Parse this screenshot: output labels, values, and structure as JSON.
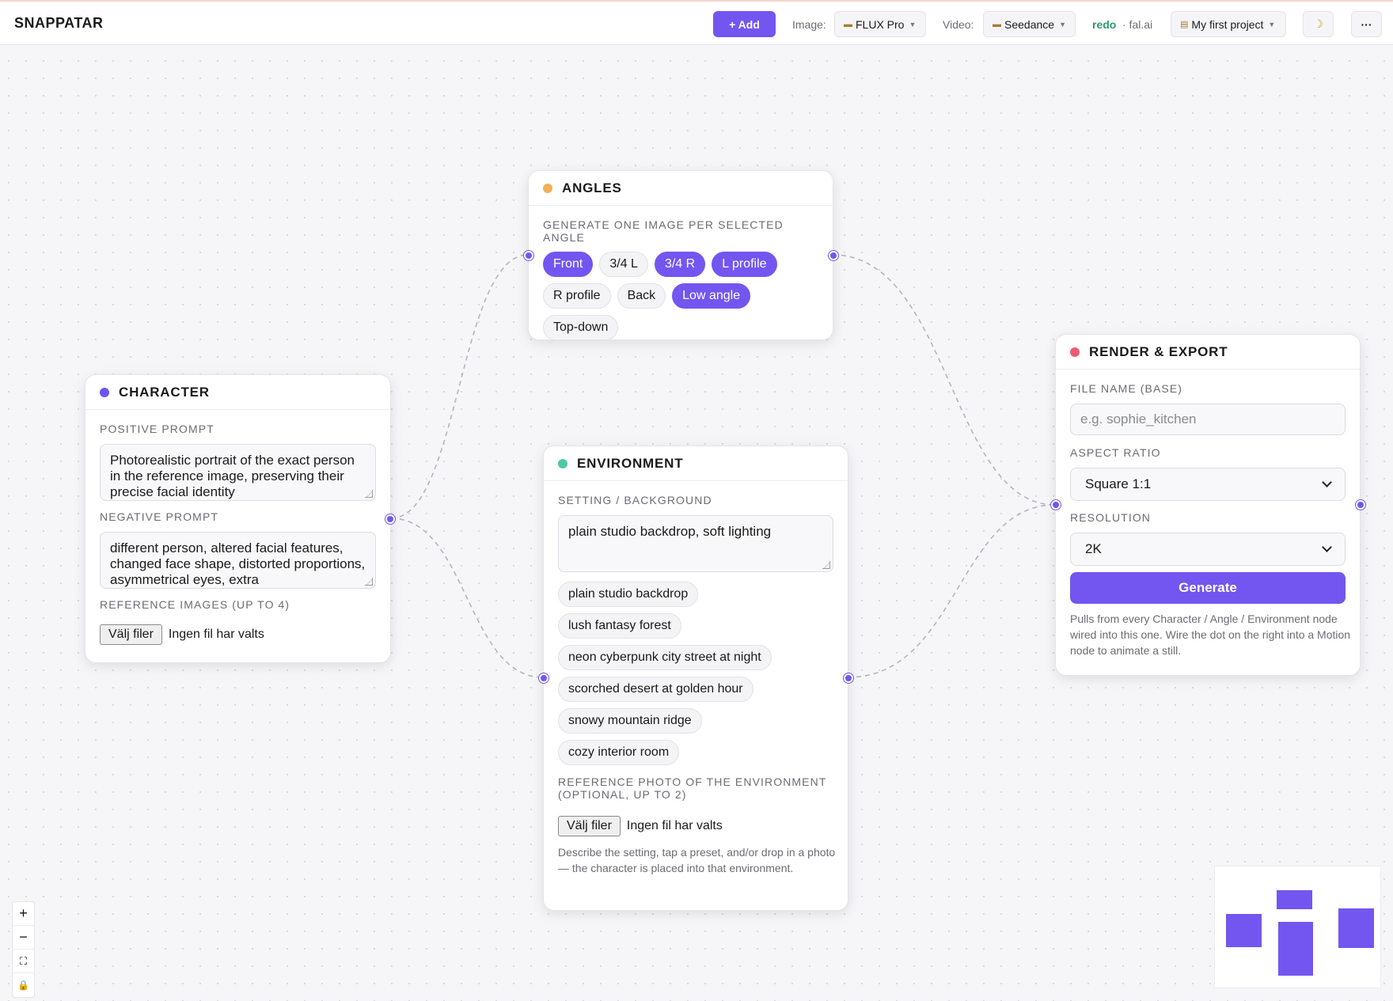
{
  "app": {
    "brand": "SNAPPATAR"
  },
  "toolbar": {
    "add_label": "+ Add",
    "image_label": "Image:",
    "image_model": "FLUX Pro",
    "video_label": "Video:",
    "video_model": "Seedance",
    "redo_label": "redo",
    "provider": "· fal.ai",
    "project": "My first project",
    "theme_icon": "☽",
    "more_icon": "···"
  },
  "nodes": {
    "character": {
      "title": "CHARACTER",
      "color": "#6c54f0",
      "positive_label": "POSITIVE PROMPT",
      "positive_value": "Photorealistic portrait of the exact person in the reference image, preserving their precise facial identity",
      "negative_label": "NEGATIVE PROMPT",
      "negative_value": "different person, altered facial features, changed face shape, distorted proportions, asymmetrical eyes, extra",
      "ref_label": "REFERENCE IMAGES (UP TO 4)",
      "file_button": "Välj filer",
      "file_status": "Ingen fil har valts"
    },
    "angles": {
      "title": "ANGLES",
      "color": "#f0b157",
      "label": "GENERATE ONE IMAGE PER SELECTED ANGLE",
      "chips": [
        {
          "label": "Front",
          "selected": true
        },
        {
          "label": "3/4 L",
          "selected": false
        },
        {
          "label": "3/4 R",
          "selected": true
        },
        {
          "label": "L profile",
          "selected": true
        },
        {
          "label": "R profile",
          "selected": false
        },
        {
          "label": "Back",
          "selected": false
        },
        {
          "label": "Low angle",
          "selected": true
        },
        {
          "label": "Top-down",
          "selected": false
        }
      ]
    },
    "environment": {
      "title": "ENVIRONMENT",
      "color": "#4cc9a6",
      "setting_label": "SETTING / BACKGROUND",
      "setting_value": "plain studio backdrop, soft lighting",
      "presets": [
        "plain studio backdrop",
        "lush fantasy forest",
        "neon cyberpunk city street at night",
        "scorched desert at golden hour",
        "snowy mountain ridge",
        "cozy interior room"
      ],
      "ref_label": "REFERENCE PHOTO OF THE ENVIRONMENT (OPTIONAL, UP TO 2)",
      "file_button": "Välj filer",
      "file_status": "Ingen fil har valts",
      "help": "Describe the setting, tap a preset, and/or drop in a photo — the character is placed into that environment."
    },
    "render": {
      "title": "RENDER & EXPORT",
      "color": "#ee5a74",
      "filename_label": "FILE NAME (BASE)",
      "filename_placeholder": "e.g. sophie_kitchen",
      "aspect_label": "ASPECT RATIO",
      "aspect_value": "Square 1:1",
      "resolution_label": "RESOLUTION",
      "resolution_value": "2K",
      "generate_label": "Generate",
      "help": "Pulls from every Character / Angle / Environment node wired into this one. Wire the dot on the right into a Motion node to animate a still."
    }
  },
  "controls": {
    "zoom_in": "+",
    "zoom_out": "−",
    "fit": "⛶",
    "lock": "🔒"
  },
  "accent": "#7356f0"
}
